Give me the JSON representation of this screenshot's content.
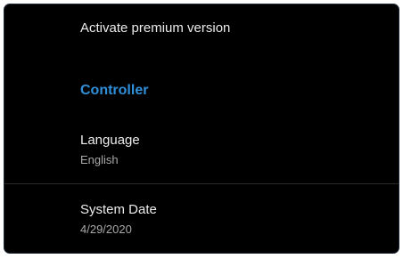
{
  "settings": {
    "premium_label": "Activate premium version",
    "section_title": "Controller",
    "language": {
      "title": "Language",
      "value": "English"
    },
    "system_date": {
      "title": "System Date",
      "value": "4/29/2020"
    }
  },
  "colors": {
    "background": "#000000",
    "accent": "#2f8fd9",
    "primary_text": "#ececec",
    "secondary_text": "#a8a8a8"
  }
}
